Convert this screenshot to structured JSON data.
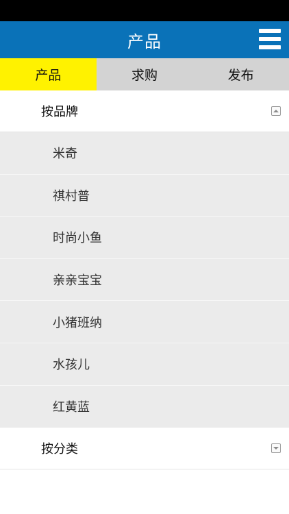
{
  "header": {
    "title": "产品"
  },
  "tabs": [
    {
      "label": "产品"
    },
    {
      "label": "求购"
    },
    {
      "label": "发布"
    }
  ],
  "sections": [
    {
      "title": "按品牌",
      "expanded": true,
      "items": [
        {
          "label": "米奇"
        },
        {
          "label": "祺村普"
        },
        {
          "label": "时尚小鱼"
        },
        {
          "label": "亲亲宝宝"
        },
        {
          "label": "小猪班纳"
        },
        {
          "label": "水孩儿"
        },
        {
          "label": "红黄蓝"
        }
      ]
    },
    {
      "title": "按分类",
      "expanded": false
    }
  ],
  "colors": {
    "app_bar": "#0a72b8",
    "active_tab": "#fff200",
    "tab_bar": "#d3d3d3",
    "sub_list_bg": "#ebebeb"
  },
  "icons": {
    "menu": "hamburger-menu-icon",
    "collapse": "collapse-arrow-icon",
    "expand": "expand-arrow-icon"
  }
}
